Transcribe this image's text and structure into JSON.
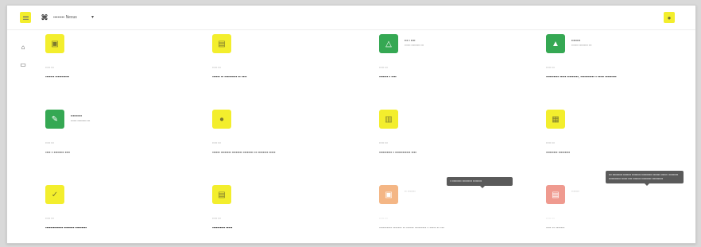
{
  "header": {
    "workspace_name": "▪▪▪▪▪▪▪▪ Nexus",
    "caret": "▾"
  },
  "tiles": [
    {
      "meta": "▪▪▪▪▪ ▪▪▪",
      "name": "▪▪▪▪▪▪▪ ▪▪▪▪▪▪▪▪▪▪▪",
      "title": "",
      "sub": ""
    },
    {
      "meta": "▪▪▪▪▪ ▪▪▪",
      "name": "▪▪▪▪▪▪ ▪▪ ▪▪▪▪▪▪▪▪▪▪ ▪▪ ▪▪▪▪",
      "title": "",
      "sub": ""
    },
    {
      "meta": "▪▪▪▪▪ ▪▪▪",
      "name": "▪▪▪▪▪▪▪ ▪ ▪▪▪▪",
      "title": "▪▪▪ ▪ ▪▪▪▪",
      "sub": "▪▪▪▪▪▪ ▪▪▪▪▪▪▪▪▪ ▪▪▪"
    },
    {
      "meta": "▪▪▪▪▪ ▪▪▪",
      "name": "▪▪▪▪▪▪▪▪▪▪ ▪▪▪▪▪ ▪▪▪▪▪▪▪▪▪, ▪▪▪▪▪▪▪▪▪▪▪ ▪ ▪▪▪▪▪ ▪▪▪▪▪▪▪▪▪",
      "title": "▪▪▪▪▪▪▪▪",
      "sub": "▪▪▪▪▪▪▪ ▪▪▪▪▪▪▪▪▪ ▪▪▪"
    },
    {
      "meta": "▪▪▪▪▪ ▪▪▪",
      "name": "▪▪▪▪ ▪ ▪▪▪▪▪▪▪▪ ▪▪▪▪",
      "title": "▪▪▪▪▪▪▪▪▪▪",
      "sub": "▪▪▪▪▪▪ ▪▪▪▪▪▪▪▪▪ ▪▪▪"
    },
    {
      "meta": "▪▪▪▪▪ ▪▪▪",
      "name": "▪▪▪▪▪▪ ▪▪▪▪▪▪▪▪ ▪▪▪▪▪▪▪▪ ▪▪▪▪▪▪▪▪ ▪▪ ▪▪▪▪▪▪▪▪ ▪▪▪▪▪",
      "title": "",
      "sub": ""
    },
    {
      "meta": "▪▪▪▪▪ ▪▪▪",
      "name": "▪▪▪▪▪▪▪▪▪▪ ▪ ▪▪▪▪▪▪▪▪▪▪▪▪ ▪▪▪▪",
      "title": "",
      "sub": ""
    },
    {
      "meta": "▪▪▪▪▪ ▪▪▪",
      "name": "▪▪▪▪▪▪▪▪▪ ▪▪▪▪▪▪▪▪▪",
      "title": "",
      "sub": ""
    },
    {
      "meta": "▪▪▪▪▪ ▪▪▪",
      "name": "▪▪▪▪▪▪▪▪▪▪▪▪▪▪ ▪▪▪▪▪▪▪▪ ▪▪▪▪▪▪▪▪▪",
      "title": "",
      "sub": ""
    },
    {
      "meta": "▪▪▪▪▪ ▪▪▪",
      "name": "▪▪▪▪▪▪▪▪▪▪ ▪▪▪▪▪",
      "title": "",
      "sub": ""
    },
    {
      "meta": "▪▪▪▪▪ ▪▪▪",
      "name": "▪▪▪▪▪▪▪▪▪▪ ▪▪▪▪▪▪▪ ▪▪ ▪▪▪▪▪▪ ▪▪▪▪▪▪▪▪▪ ▪ ▪▪▪▪▪ ▪▪ ▪▪▪",
      "title": "▪▪ ▪▪▪▪▪▪▪",
      "sub": ""
    },
    {
      "meta": "▪▪▪▪▪ ▪▪▪",
      "name": "▪▪▪▪ ▪▪ ▪▪▪▪▪▪▪",
      "title": "▪▪▪▪▪▪▪",
      "sub": ""
    }
  ],
  "tooltips": {
    "tip1": "▪ ▪▪▪▪▪▪▪▪▪▪ ▪▪▪▪▪▪▪▪▪▪ ▪▪▪▪▪▪▪▪▪",
    "tip2": "▪▪▪ ▪▪▪▪▪▪▪▪▪▪ ▪▪▪▪▪▪▪▪ ▪▪▪▪▪▪▪▪▪ ▪▪▪▪▪▪▪▪▪▪▪ ▪▪▪▪▪▪▪ ▪▪▪▪▪▪ ▪ ▪▪▪▪▪▪▪▪▪ ▪▪▪▪▪▪▪▪▪▪▪▪ ▪▪▪▪▪▪ ▪▪▪▪ ▪▪▪▪▪▪▪▪ ▪▪▪▪▪▪▪▪▪▪ ▪▪▪▪▪▪▪▪▪▪▪"
  },
  "colors": {
    "accent_yellow": "#f3ee2d",
    "green": "#35a853",
    "orange": "#f4b685",
    "red": "#ef9a8f"
  },
  "icons": [
    "menu-icon",
    "workspace-icon",
    "chevron-down-icon",
    "shield-icon",
    "folder-icon"
  ]
}
